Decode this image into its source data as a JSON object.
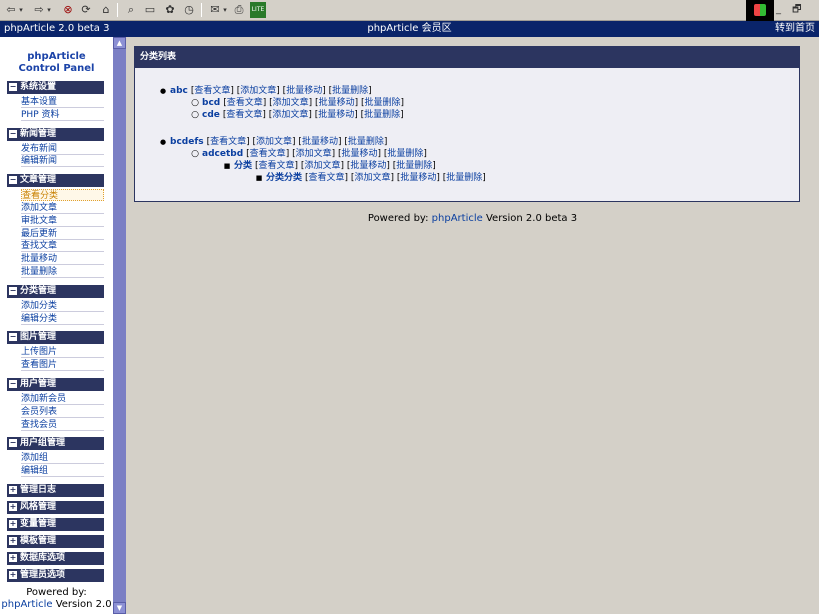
{
  "browser": {
    "toolbar_icons": [
      "back-icon",
      "forward-icon",
      "stop-icon",
      "refresh-icon",
      "home-icon",
      "search-icon",
      "folder-icon",
      "favorites-icon",
      "history-icon",
      "mail-icon",
      "print-icon",
      "lite-icon"
    ],
    "win_controls": "_ 🗗 ×"
  },
  "titlebar": {
    "left": "phpArticle 2.0 beta 3",
    "center": "phpArticle 会员区",
    "right": "转到首页"
  },
  "sidebar": {
    "title_line1": "phpArticle",
    "title_line2": "Control Panel",
    "sections": [
      {
        "label": "系统设置",
        "sign": "−",
        "items": [
          "基本设置",
          "PHP 资料"
        ]
      },
      {
        "label": "新闻管理",
        "sign": "−",
        "items": [
          "发布新闻",
          "编辑新闻"
        ]
      },
      {
        "label": "文章管理",
        "sign": "−",
        "items": [
          "查看分类",
          "添加文章",
          "审批文章",
          "最后更新",
          "查找文章",
          "批量移动",
          "批量删除"
        ]
      },
      {
        "label": "分类管理",
        "sign": "−",
        "items": [
          "添加分类",
          "编辑分类"
        ]
      },
      {
        "label": "图片管理",
        "sign": "−",
        "items": [
          "上传图片",
          "查看图片"
        ]
      },
      {
        "label": "用户管理",
        "sign": "−",
        "items": [
          "添加新会员",
          "会员列表",
          "查找会员"
        ]
      },
      {
        "label": "用户组管理",
        "sign": "−",
        "items": [
          "添加组",
          "编辑组"
        ]
      },
      {
        "label": "管理日志",
        "sign": "+",
        "items": []
      },
      {
        "label": "风格管理",
        "sign": "+",
        "items": []
      },
      {
        "label": "变量管理",
        "sign": "+",
        "items": []
      },
      {
        "label": "模板管理",
        "sign": "+",
        "items": []
      },
      {
        "label": "数据库选项",
        "sign": "+",
        "items": []
      },
      {
        "label": "管理员选项",
        "sign": "+",
        "items": []
      }
    ],
    "active_item": "查看分类",
    "footer_line1": "Powered by:",
    "footer_link": "phpArticle",
    "footer_version": " Version 2.0"
  },
  "content": {
    "panel_title": "分类列表",
    "actions": [
      "查看文章",
      "添加文章",
      "批量移动",
      "批量删除"
    ],
    "categories": [
      {
        "name": "abc",
        "level": 0,
        "bullet": "●"
      },
      {
        "name": "bcd",
        "level": 1,
        "bullet": "○"
      },
      {
        "name": "cde",
        "level": 1,
        "bullet": "○"
      },
      {
        "name": "bcdefs",
        "level": 0,
        "bullet": "●"
      },
      {
        "name": "adcetbd",
        "level": 1,
        "bullet": "○"
      },
      {
        "name": "分类",
        "level": 2,
        "bullet": "■"
      },
      {
        "name": "分类分类",
        "level": 3,
        "bullet": "■"
      }
    ],
    "powered_prefix": "Powered by: ",
    "powered_link": "phpArticle",
    "powered_suffix": " Version 2.0 beta 3"
  },
  "colors": {
    "section_header": "#2c3560",
    "titlebar": "#0a246a",
    "link": "#0b3fa0",
    "active_item": "#c88000"
  }
}
